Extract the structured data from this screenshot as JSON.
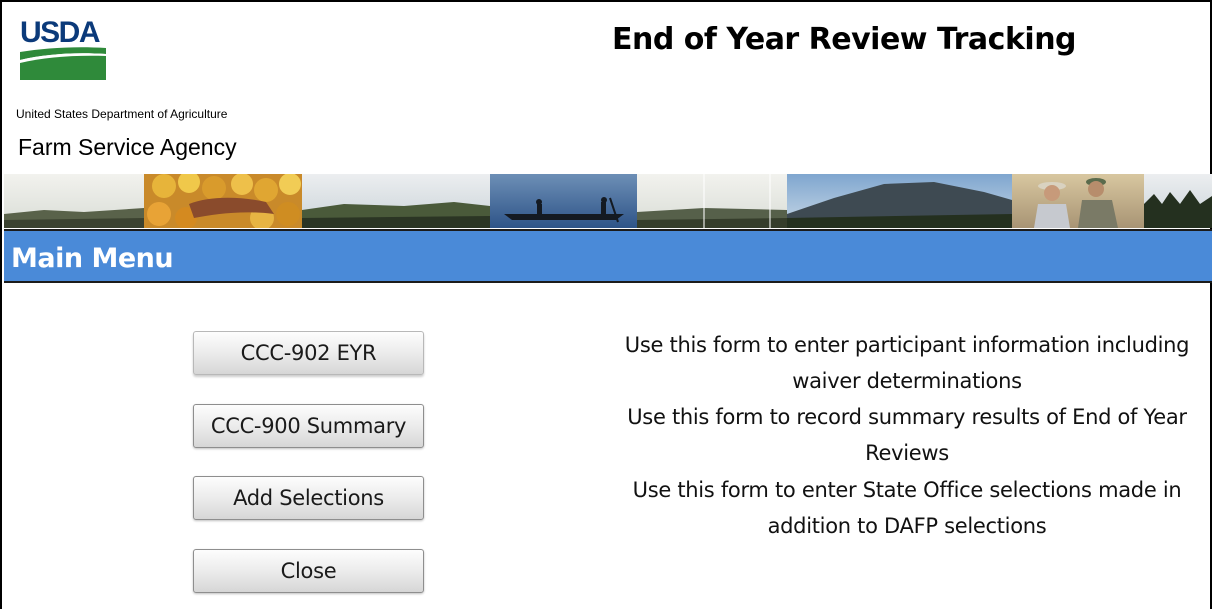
{
  "header": {
    "logo_text": "USDA",
    "department": "United States Department of Agriculture",
    "agency": "Farm Service Agency",
    "app_title": "End of Year Review Tracking"
  },
  "colors": {
    "menu_bar": "#4a8ad8",
    "usda_blue": "#0b3a7a",
    "usda_green": "#2f8a3a"
  },
  "menu": {
    "title": "Main Menu",
    "items": [
      {
        "label": "CCC-902 EYR",
        "description": "Use this form to enter participant information including waiver determinations"
      },
      {
        "label": "CCC-900 Summary",
        "description": "Use this form to record summary results of End of Year Reviews"
      },
      {
        "label": "Add Selections",
        "description": "Use this form to enter State Office selections made in addition to DAFP selections"
      },
      {
        "label": "Close"
      }
    ]
  }
}
